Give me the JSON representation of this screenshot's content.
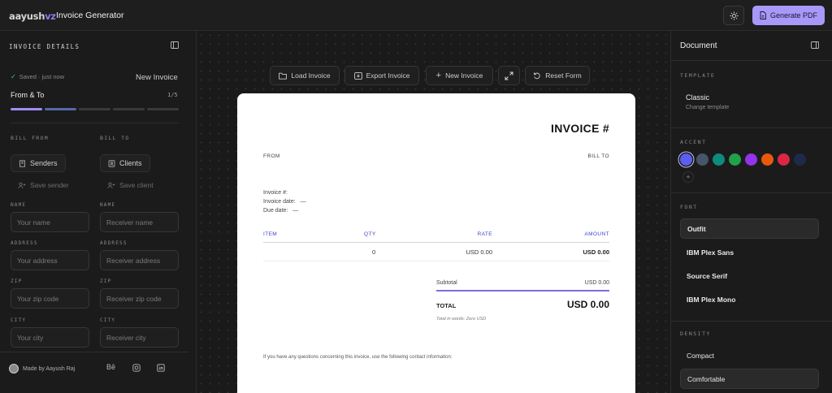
{
  "topbar": {
    "logo_main": "aayush",
    "logo_accent": "vz",
    "title": "Invoice Generator",
    "generate_label": "Generate PDF"
  },
  "left": {
    "heading": "INVOICE DETAILS",
    "saved_status": "Saved · just now",
    "invoice_status": "New Invoice",
    "step_title": "From & To",
    "step_count": "1/5",
    "progress_steps": 5,
    "current_step": 1,
    "bill_from_label": "BILL FROM",
    "bill_to_label": "BILL TO",
    "senders_label": "Senders",
    "clients_label": "Clients",
    "save_sender_label": "Save sender",
    "save_client_label": "Save client",
    "from_fields": {
      "name": {
        "label": "NAME",
        "placeholder": "Your name"
      },
      "address": {
        "label": "ADDRESS",
        "placeholder": "Your address"
      },
      "zip": {
        "label": "ZIP",
        "placeholder": "Your zip code"
      },
      "city": {
        "label": "CITY",
        "placeholder": "Your city"
      }
    },
    "to_fields": {
      "name": {
        "label": "NAME",
        "placeholder": "Receiver name"
      },
      "address": {
        "label": "ADDRESS",
        "placeholder": "Receiver address"
      },
      "zip": {
        "label": "ZIP",
        "placeholder": "Receiver zip code"
      },
      "city": {
        "label": "CITY",
        "placeholder": "Receiver city"
      }
    },
    "footer": {
      "made_by": "Made by Aayush Raj",
      "behance": "Bē"
    }
  },
  "toolbar": {
    "load": "Load Invoice",
    "export": "Export Invoice",
    "new": "New Invoice",
    "reset": "Reset Form"
  },
  "preview": {
    "title": "INVOICE #",
    "from_label": "FROM",
    "bill_to_label": "BILL TO",
    "invoice_no_label": "Invoice #:",
    "invoice_date_label": "Invoice date:",
    "invoice_date_value": "—",
    "due_date_label": "Due date:",
    "due_date_value": "—",
    "table": {
      "headers": [
        "ITEM",
        "QTY",
        "RATE",
        "AMOUNT"
      ],
      "rows": [
        {
          "item": "",
          "qty": "0",
          "rate": "USD 0.00",
          "amount": "USD 0.00"
        }
      ]
    },
    "subtotal_label": "Subtotal",
    "subtotal_value": "USD 0.00",
    "total_label": "TOTAL",
    "total_value": "USD 0.00",
    "total_words": "Total in words: Zero USD",
    "note": "If you have any questions concerning this invoice, use the following contact information:"
  },
  "right": {
    "title": "Document",
    "template_section": "TEMPLATE",
    "template_name": "Classic",
    "template_action": "Change template",
    "accent_section": "ACCENT",
    "accents": [
      "#5b5ff0",
      "#475569",
      "#0f8a80",
      "#22a04a",
      "#9333ea",
      "#ea580c",
      "#dc2645",
      "#1e2a4a"
    ],
    "selected_accent": 0,
    "add_accent": "+",
    "font_section": "FONT",
    "fonts": [
      "Outfit",
      "IBM Plex Sans",
      "Source Serif",
      "IBM Plex Mono"
    ],
    "selected_font": 0,
    "density_section": "DENSITY",
    "densities": [
      "Compact",
      "Comfortable"
    ],
    "selected_density": 1
  }
}
